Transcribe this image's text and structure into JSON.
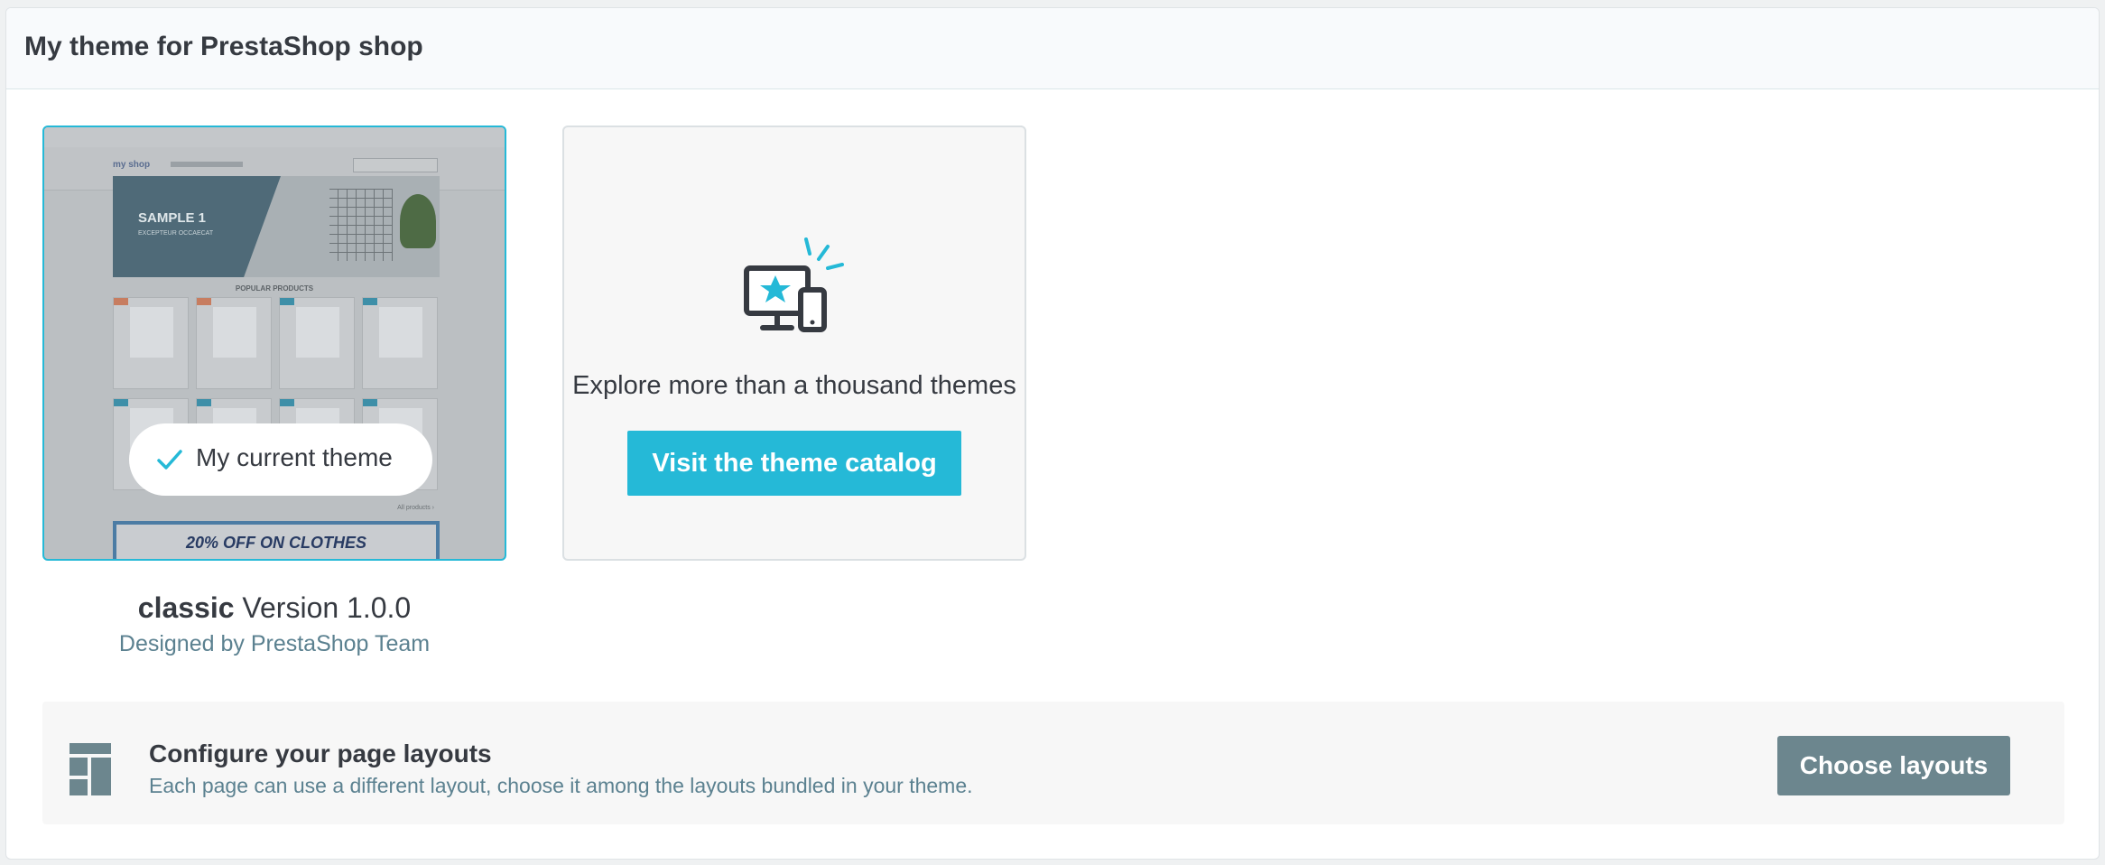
{
  "header": {
    "title": "My theme for PrestaShop shop"
  },
  "current_theme": {
    "badge_label": "My current theme",
    "name": "classic",
    "version_label": "Version 1.0.0",
    "author": "Designed by PrestaShop Team",
    "thumbnail": {
      "logo": "my shop",
      "hero_title": "SAMPLE 1",
      "hero_subtitle": "EXCEPTEUR OCCAECAT",
      "section_title": "POPULAR PRODUCTS",
      "all_products_link": "All products ›",
      "banner_text": "20% OFF ON CLOTHES"
    }
  },
  "catalog": {
    "text": "Explore more than a thousand themes",
    "button_label": "Visit the theme catalog"
  },
  "layouts": {
    "title": "Configure your page layouts",
    "description": "Each page can use a different layout, choose it among the layouts bundled in your theme.",
    "button_label": "Choose layouts"
  },
  "colors": {
    "accent": "#25b9d7",
    "secondary_button": "#6c868e",
    "muted_text": "#5b8190"
  }
}
